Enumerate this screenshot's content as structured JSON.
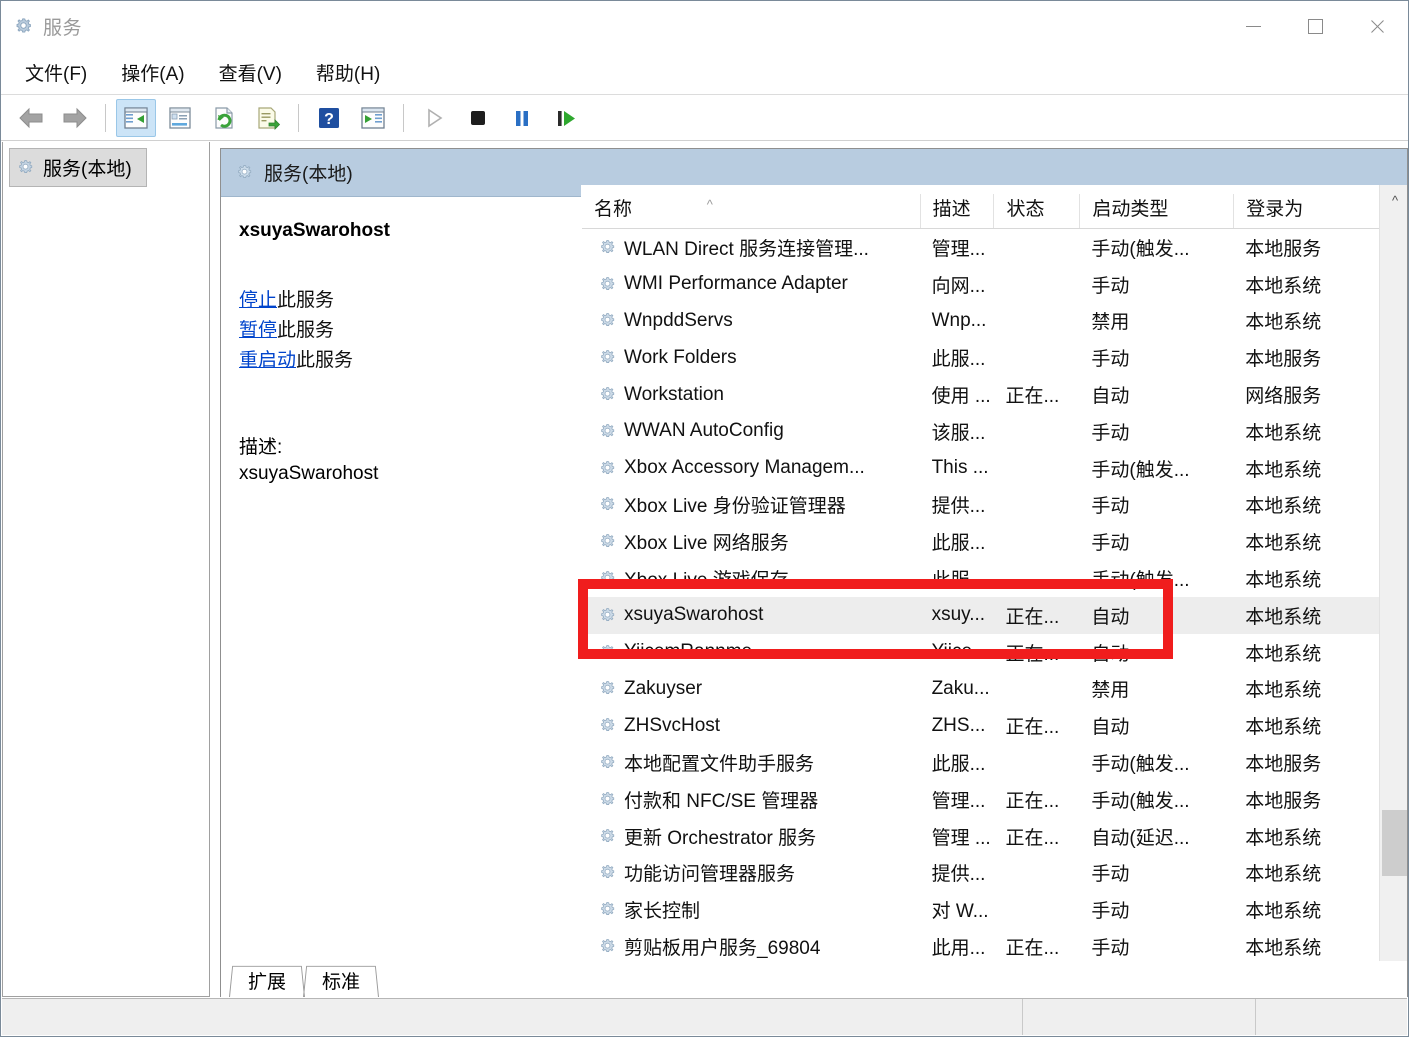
{
  "window": {
    "title": "服务",
    "icon": "gear-icon",
    "controls": {
      "minimize": "—",
      "maximize": "□",
      "close": "✕"
    }
  },
  "menu": {
    "items": [
      {
        "label": "文件(F)",
        "name": "menu-file"
      },
      {
        "label": "操作(A)",
        "name": "menu-action"
      },
      {
        "label": "查看(V)",
        "name": "menu-view"
      },
      {
        "label": "帮助(H)",
        "name": "menu-help"
      }
    ]
  },
  "toolbar": {
    "buttons": [
      {
        "icon": "back-arrow-icon",
        "enabled": true
      },
      {
        "icon": "forward-arrow-icon",
        "enabled": true
      },
      {
        "icon": "show-hide-tree-icon",
        "enabled": true,
        "active": true
      },
      {
        "icon": "properties-icon",
        "enabled": true
      },
      {
        "icon": "refresh-icon",
        "enabled": true
      },
      {
        "icon": "export-list-icon",
        "enabled": true
      },
      {
        "icon": "help-icon",
        "enabled": true
      },
      {
        "icon": "show-console-icon",
        "enabled": true
      },
      {
        "icon": "start-service-icon",
        "enabled": false
      },
      {
        "icon": "stop-service-icon",
        "enabled": true
      },
      {
        "icon": "pause-service-icon",
        "enabled": true
      },
      {
        "icon": "restart-service-icon",
        "enabled": true
      }
    ]
  },
  "sidebar": {
    "node_label": "服务(本地)"
  },
  "pane_header": {
    "title": "服务(本地)"
  },
  "detail": {
    "service_name": "xsuyaSwarohost",
    "links": [
      {
        "link_text": "停止",
        "suffix": "此服务",
        "name": "stop-service-link"
      },
      {
        "link_text": "暂停",
        "suffix": "此服务",
        "name": "pause-service-link"
      },
      {
        "link_text": "重启动",
        "suffix": "此服务",
        "name": "restart-service-link"
      }
    ],
    "description_label": "描述:",
    "description_body": "xsuyaSwarohost"
  },
  "list": {
    "columns": [
      {
        "label": "名称",
        "key": "name",
        "sorted": "asc"
      },
      {
        "label": "描述",
        "key": "desc"
      },
      {
        "label": "状态",
        "key": "status"
      },
      {
        "label": "启动类型",
        "key": "start"
      },
      {
        "label": "登录为",
        "key": "logon"
      }
    ],
    "rows": [
      {
        "name": "WLAN Direct 服务连接管理...",
        "desc": "管理...",
        "status": "",
        "start": "手动(触发...",
        "logon": "本地服务",
        "selected": false
      },
      {
        "name": "WMI Performance Adapter",
        "desc": "向网...",
        "status": "",
        "start": "手动",
        "logon": "本地系统",
        "selected": false
      },
      {
        "name": "WnpddServs",
        "desc": "Wnp...",
        "status": "",
        "start": "禁用",
        "logon": "本地系统",
        "selected": false
      },
      {
        "name": "Work Folders",
        "desc": "此服...",
        "status": "",
        "start": "手动",
        "logon": "本地服务",
        "selected": false
      },
      {
        "name": "Workstation",
        "desc": "使用 ...",
        "status": "正在...",
        "start": "自动",
        "logon": "网络服务",
        "selected": false
      },
      {
        "name": "WWAN AutoConfig",
        "desc": "该服...",
        "status": "",
        "start": "手动",
        "logon": "本地系统",
        "selected": false
      },
      {
        "name": "Xbox Accessory Managem...",
        "desc": "This ...",
        "status": "",
        "start": "手动(触发...",
        "logon": "本地系统",
        "selected": false
      },
      {
        "name": "Xbox Live 身份验证管理器",
        "desc": "提供...",
        "status": "",
        "start": "手动",
        "logon": "本地系统",
        "selected": false
      },
      {
        "name": "Xbox Live 网络服务",
        "desc": "此服...",
        "status": "",
        "start": "手动",
        "logon": "本地系统",
        "selected": false
      },
      {
        "name": "Xbox Live 游戏保存",
        "desc": "此服...",
        "status": "",
        "start": "手动(触发...",
        "logon": "本地系统",
        "selected": false
      },
      {
        "name": "xsuyaSwarohost",
        "desc": "xsuy...",
        "status": "正在...",
        "start": "自动",
        "logon": "本地系统",
        "selected": true
      },
      {
        "name": "YiicemRannme",
        "desc": "Yiice...",
        "status": "正在...",
        "start": "自动",
        "logon": "本地系统",
        "selected": false
      },
      {
        "name": "Zakuyser",
        "desc": "Zaku...",
        "status": "",
        "start": "禁用",
        "logon": "本地系统",
        "selected": false
      },
      {
        "name": "ZHSvcHost",
        "desc": "ZHS...",
        "status": "正在...",
        "start": "自动",
        "logon": "本地系统",
        "selected": false
      },
      {
        "name": "本地配置文件助手服务",
        "desc": "此服...",
        "status": "",
        "start": "手动(触发...",
        "logon": "本地服务",
        "selected": false
      },
      {
        "name": "付款和 NFC/SE 管理器",
        "desc": "管理...",
        "status": "正在...",
        "start": "手动(触发...",
        "logon": "本地服务",
        "selected": false
      },
      {
        "name": "更新 Orchestrator 服务",
        "desc": "管理 ...",
        "status": "正在...",
        "start": "自动(延迟...",
        "logon": "本地系统",
        "selected": false
      },
      {
        "name": "功能访问管理器服务",
        "desc": "提供...",
        "status": "",
        "start": "手动",
        "logon": "本地系统",
        "selected": false
      },
      {
        "name": "家长控制",
        "desc": "对 W...",
        "status": "",
        "start": "手动",
        "logon": "本地系统",
        "selected": false
      },
      {
        "name": "剪贴板用户服务_69804",
        "desc": "此用...",
        "status": "正在...",
        "start": "手动",
        "logon": "本地系统",
        "selected": false
      }
    ]
  },
  "tabs": [
    {
      "label": "扩展",
      "name": "tab-extended",
      "active": false
    },
    {
      "label": "标准",
      "name": "tab-standard",
      "active": true
    }
  ],
  "annotation": {
    "color": "#f01d1d",
    "target_row": "xsuyaSwarohost"
  }
}
